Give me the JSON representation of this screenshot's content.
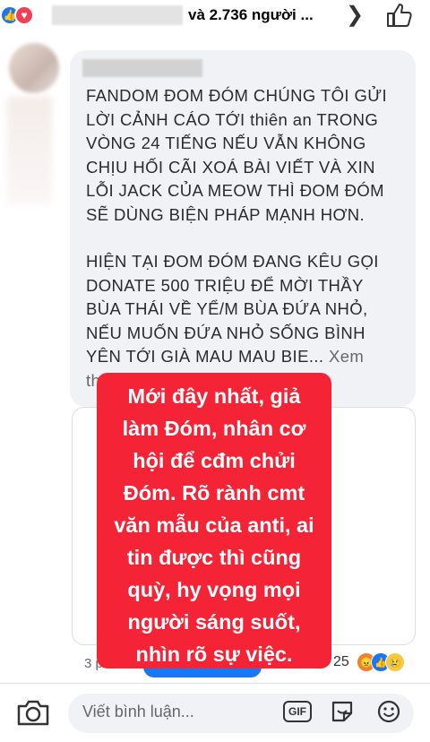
{
  "header": {
    "reactors_text": "và 2.736 người ...",
    "icons": [
      "like-icon",
      "love-icon",
      "chevron-right-icon",
      "thumbs-up-icon"
    ]
  },
  "comment": {
    "paragraph1": "FANDOM ĐOM ĐÓM CHÚNG TÔI GỬI\nLỜI CẢNH CÁO TỚI thiên an TRONG\nVÒNG 24 TIẾNG NẾU VẪN KHÔNG\nCHỊU HỐI CÃI XOÁ BÀI VIẾT VÀ XIN\nLỖI JACK CỦA MEOW THÌ ĐOM ĐÓM\nSẼ DÙNG BIỆN PHÁP MẠNH HƠN.",
    "paragraph2": "HIỆN TẠI ĐOM ĐÓM ĐANG KÊU GỌI\nDONATE 500 TRIỆU ĐỂ MỜI THẦY\nBÙA THÁI VỀ YỂ/M BÙA ĐỨA NHỎ,\nNẾU MUỐN ĐỨA NHỎ SỐNG BÌNH\nYÊN TỚI GIÀ MAU MAU BIE...",
    "see_more": "Xem\nth"
  },
  "overlay": {
    "text": "Mới đây nhất, giả\nlàm Đóm, nhân cơ\nhội để cđm chửi\nĐóm. Rõ rành cmt\nvăn mẫu của anti, ai\ntin được thì cũng\nquỳ, hy vọng mọi\nngười sáng suốt,\nnhìn rõ sự việc.",
    "color": "#f42336"
  },
  "meta": {
    "time": "3 phú",
    "reaction_count": "25"
  },
  "composer": {
    "placeholder": "Viết bình luận...",
    "gif_label": "GIF"
  },
  "colors": {
    "facebook_blue": "#1877f2",
    "bubble_bg": "#f0f2f5"
  }
}
